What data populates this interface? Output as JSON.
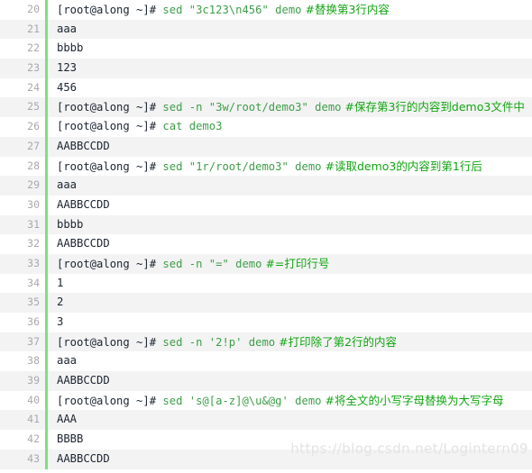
{
  "watermark": "https://blog.csdn.net/Logintern09",
  "colors": {
    "prompt": "#1b2430",
    "command": "#3f9e4a",
    "comment": "#12a512",
    "output": "#1b2430",
    "gutter_text": "#a9a9a9",
    "gutter_bar": "#7ee07e",
    "row_alt_bg": "#f3f3f3",
    "row_bg": "#ffffff"
  },
  "code_block": {
    "first_line_number": 20,
    "lines": [
      {
        "number": "20",
        "kind": "command",
        "prompt": "[root@along ~]# ",
        "command": "sed \"3c123\\n456\" demo",
        "comment": "  #替换第3行内容"
      },
      {
        "number": "21",
        "kind": "output",
        "text": "aaa"
      },
      {
        "number": "22",
        "kind": "output",
        "text": "bbbb"
      },
      {
        "number": "23",
        "kind": "output",
        "text": "123"
      },
      {
        "number": "24",
        "kind": "output",
        "text": "456"
      },
      {
        "number": "25",
        "kind": "command",
        "prompt": "[root@along ~]# ",
        "command": "sed -n \"3w/root/demo3\" demo",
        "comment": "  #保存第3行的内容到demo3文件中"
      },
      {
        "number": "26",
        "kind": "command",
        "prompt": "[root@along ~]# ",
        "command": "cat demo3",
        "comment": ""
      },
      {
        "number": "27",
        "kind": "output",
        "text": "AABBCCDD"
      },
      {
        "number": "28",
        "kind": "command",
        "prompt": "[root@along ~]# ",
        "command": "sed \"1r/root/demo3\" demo",
        "comment": "  #读取demo3的内容到第1行后"
      },
      {
        "number": "29",
        "kind": "output",
        "text": "aaa"
      },
      {
        "number": "30",
        "kind": "output",
        "text": "AABBCCDD"
      },
      {
        "number": "31",
        "kind": "output",
        "text": "bbbb"
      },
      {
        "number": "32",
        "kind": "output",
        "text": "AABBCCDD"
      },
      {
        "number": "33",
        "kind": "command",
        "prompt": "[root@along ~]# ",
        "command": "sed -n \"=\" demo",
        "comment": "  #=打印行号"
      },
      {
        "number": "34",
        "kind": "output",
        "text": "1"
      },
      {
        "number": "35",
        "kind": "output",
        "text": "2"
      },
      {
        "number": "36",
        "kind": "output",
        "text": "3"
      },
      {
        "number": "37",
        "kind": "command",
        "prompt": "[root@along ~]# ",
        "command": "sed -n '2!p' demo",
        "comment": "  #打印除了第2行的内容"
      },
      {
        "number": "38",
        "kind": "output",
        "text": "aaa"
      },
      {
        "number": "39",
        "kind": "output",
        "text": "AABBCCDD"
      },
      {
        "number": "40",
        "kind": "command",
        "prompt": "[root@along ~]# ",
        "command": "sed 's@[a-z]@\\u&@g' demo",
        "comment": "  #将全文的小写字母替换为大写字母"
      },
      {
        "number": "41",
        "kind": "output",
        "text": "AAA"
      },
      {
        "number": "42",
        "kind": "output",
        "text": "BBBB"
      },
      {
        "number": "43",
        "kind": "output",
        "text": "AABBCCDD"
      }
    ]
  }
}
